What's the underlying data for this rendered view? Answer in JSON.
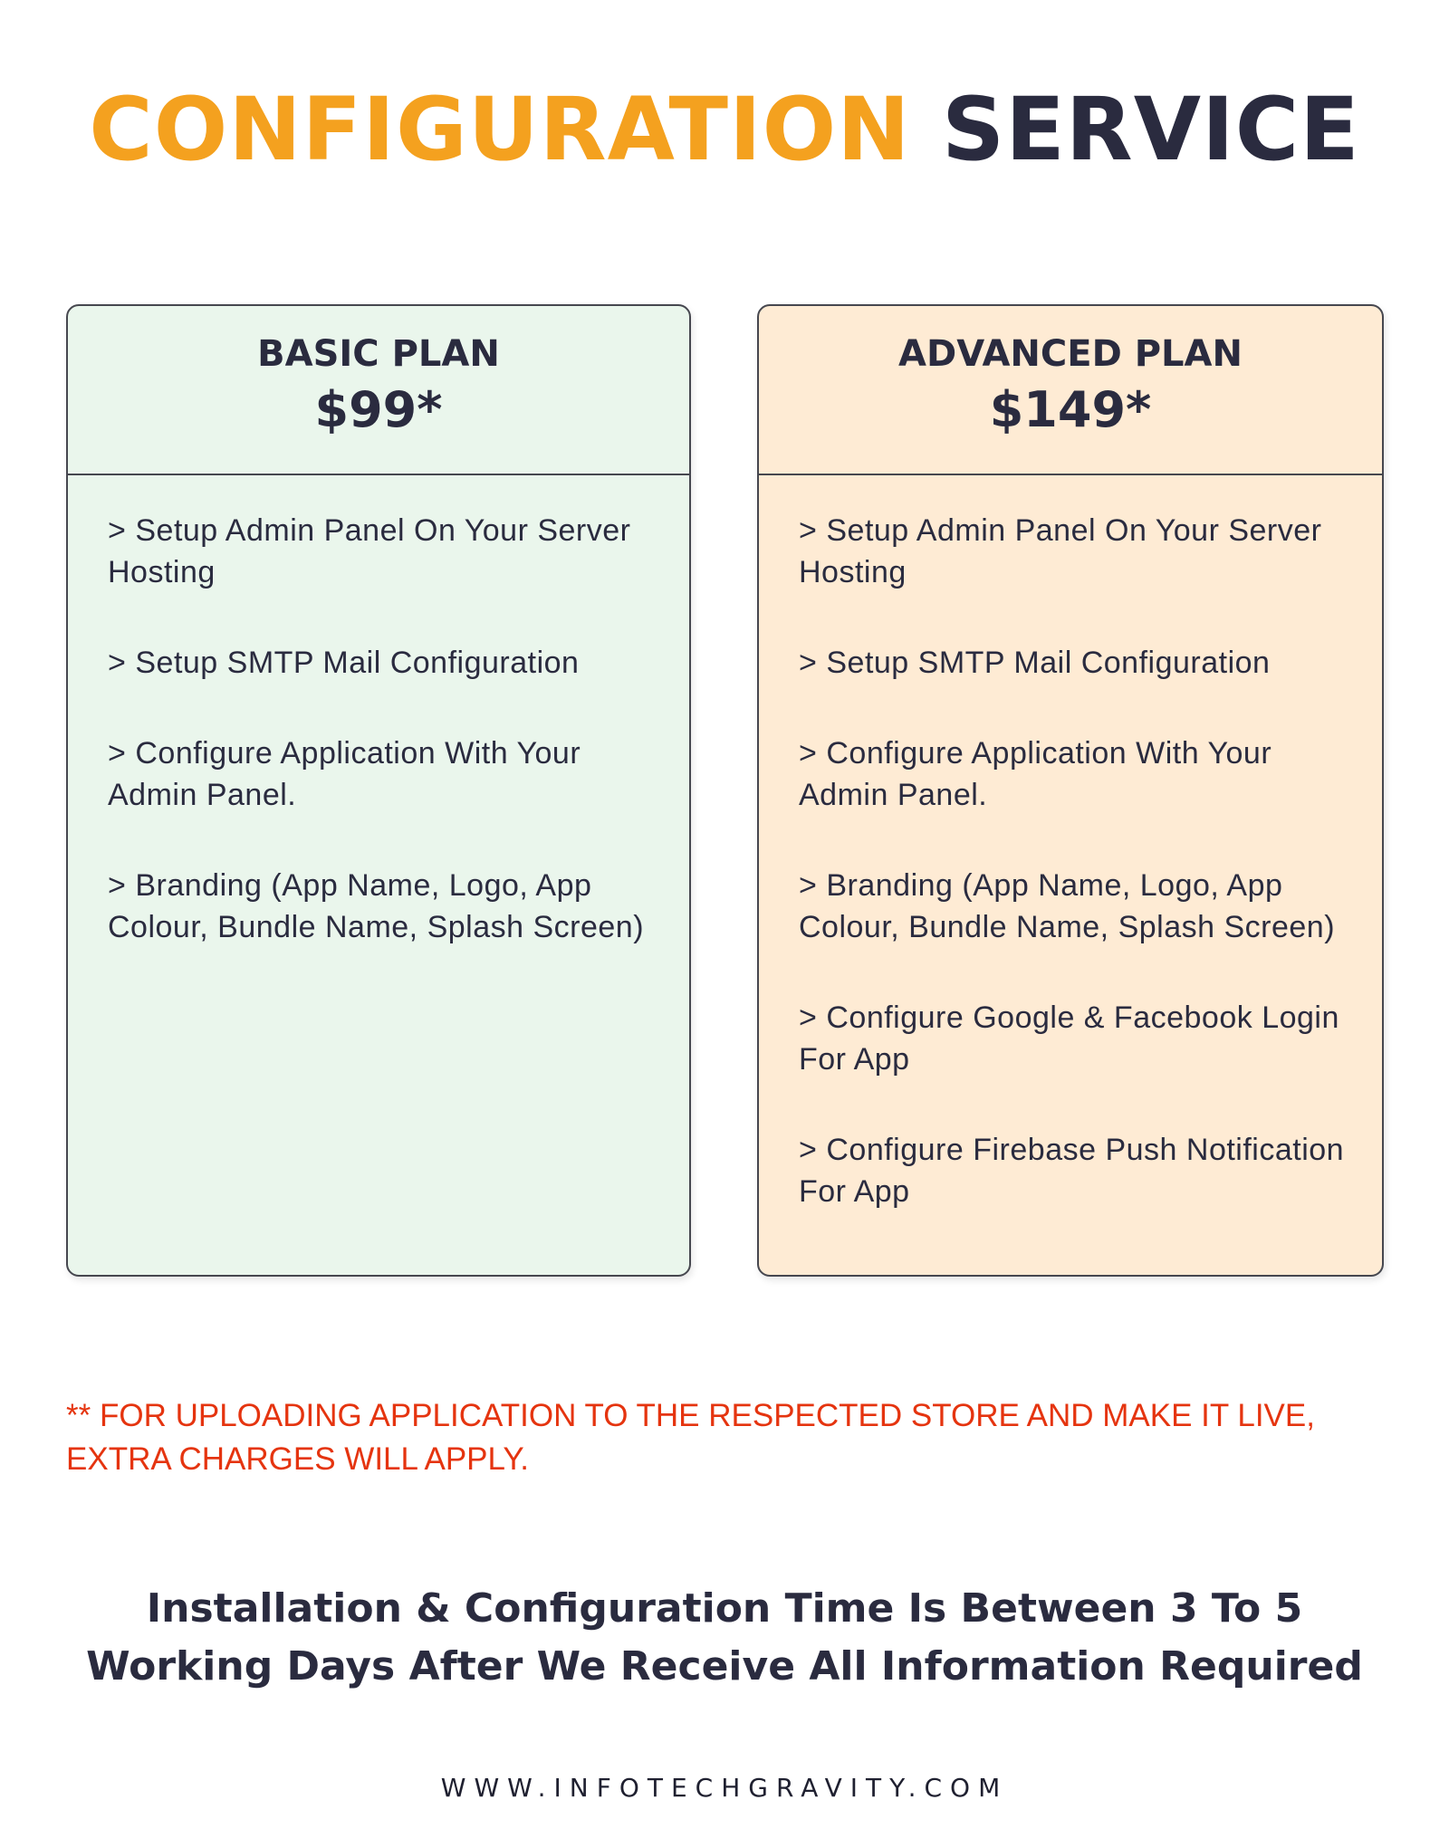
{
  "header": {
    "title_part1": "CONFIGURATION",
    "title_part2": "SERVICE"
  },
  "colors": {
    "accent": "#F4A11F",
    "dark": "#2A2B3F",
    "warning": "#E5340F",
    "basic_bg": "#EAF6EC",
    "advanced_bg": "#FEEBD4"
  },
  "plans": [
    {
      "name": "BASIC PLAN",
      "price": "$99*",
      "features": [
        "Setup Admin Panel On Your Server Hosting",
        "Setup SMTP Mail Configuration",
        "Configure Application With Your Admin Panel.",
        "Branding (App Name, Logo, App Colour, Bundle Name, Splash Screen)"
      ]
    },
    {
      "name": "ADVANCED PLAN",
      "price": "$149*",
      "features": [
        "Setup Admin Panel On Your Server Hosting",
        "Setup SMTP Mail Configuration",
        "Configure Application With Your Admin Panel.",
        "Branding (App Name, Logo, App Colour, Bundle Name, Splash Screen)",
        "Configure Google & Facebook Login For App",
        "Configure Firebase Push Notification For App"
      ]
    }
  ],
  "bullet_marker": ">",
  "note": "** FOR UPLOADING APPLICATION TO THE RESPECTED STORE AND MAKE IT LIVE, EXTRA CHARGES WILL APPLY.",
  "footer": {
    "time_line1": "Installation & Configuration Time Is Between 3 To 5",
    "time_line2": "Working Days After We Receive All Information Required",
    "website": "WWW.INFOTECHGRAVITY.COM"
  }
}
